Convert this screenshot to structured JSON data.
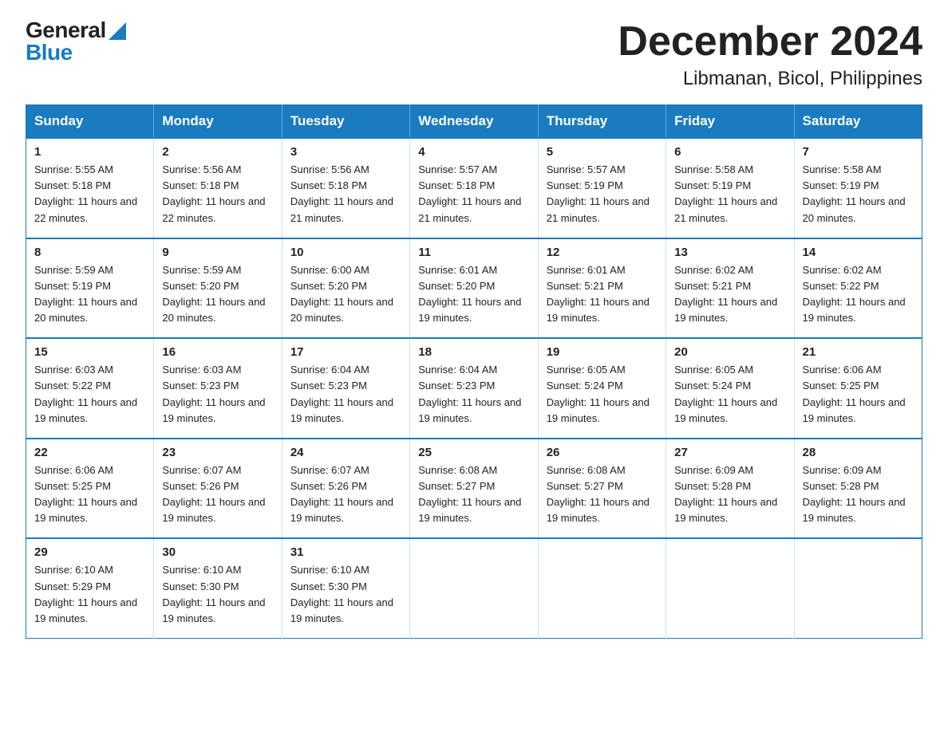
{
  "logo": {
    "general": "General",
    "blue": "Blue"
  },
  "title": "December 2024",
  "subtitle": "Libmanan, Bicol, Philippines",
  "weekdays": [
    "Sunday",
    "Monday",
    "Tuesday",
    "Wednesday",
    "Thursday",
    "Friday",
    "Saturday"
  ],
  "weeks": [
    [
      {
        "day": "1",
        "sunrise": "5:55 AM",
        "sunset": "5:18 PM",
        "daylight": "11 hours and 22 minutes."
      },
      {
        "day": "2",
        "sunrise": "5:56 AM",
        "sunset": "5:18 PM",
        "daylight": "11 hours and 22 minutes."
      },
      {
        "day": "3",
        "sunrise": "5:56 AM",
        "sunset": "5:18 PM",
        "daylight": "11 hours and 21 minutes."
      },
      {
        "day": "4",
        "sunrise": "5:57 AM",
        "sunset": "5:18 PM",
        "daylight": "11 hours and 21 minutes."
      },
      {
        "day": "5",
        "sunrise": "5:57 AM",
        "sunset": "5:19 PM",
        "daylight": "11 hours and 21 minutes."
      },
      {
        "day": "6",
        "sunrise": "5:58 AM",
        "sunset": "5:19 PM",
        "daylight": "11 hours and 21 minutes."
      },
      {
        "day": "7",
        "sunrise": "5:58 AM",
        "sunset": "5:19 PM",
        "daylight": "11 hours and 20 minutes."
      }
    ],
    [
      {
        "day": "8",
        "sunrise": "5:59 AM",
        "sunset": "5:19 PM",
        "daylight": "11 hours and 20 minutes."
      },
      {
        "day": "9",
        "sunrise": "5:59 AM",
        "sunset": "5:20 PM",
        "daylight": "11 hours and 20 minutes."
      },
      {
        "day": "10",
        "sunrise": "6:00 AM",
        "sunset": "5:20 PM",
        "daylight": "11 hours and 20 minutes."
      },
      {
        "day": "11",
        "sunrise": "6:01 AM",
        "sunset": "5:20 PM",
        "daylight": "11 hours and 19 minutes."
      },
      {
        "day": "12",
        "sunrise": "6:01 AM",
        "sunset": "5:21 PM",
        "daylight": "11 hours and 19 minutes."
      },
      {
        "day": "13",
        "sunrise": "6:02 AM",
        "sunset": "5:21 PM",
        "daylight": "11 hours and 19 minutes."
      },
      {
        "day": "14",
        "sunrise": "6:02 AM",
        "sunset": "5:22 PM",
        "daylight": "11 hours and 19 minutes."
      }
    ],
    [
      {
        "day": "15",
        "sunrise": "6:03 AM",
        "sunset": "5:22 PM",
        "daylight": "11 hours and 19 minutes."
      },
      {
        "day": "16",
        "sunrise": "6:03 AM",
        "sunset": "5:23 PM",
        "daylight": "11 hours and 19 minutes."
      },
      {
        "day": "17",
        "sunrise": "6:04 AM",
        "sunset": "5:23 PM",
        "daylight": "11 hours and 19 minutes."
      },
      {
        "day": "18",
        "sunrise": "6:04 AM",
        "sunset": "5:23 PM",
        "daylight": "11 hours and 19 minutes."
      },
      {
        "day": "19",
        "sunrise": "6:05 AM",
        "sunset": "5:24 PM",
        "daylight": "11 hours and 19 minutes."
      },
      {
        "day": "20",
        "sunrise": "6:05 AM",
        "sunset": "5:24 PM",
        "daylight": "11 hours and 19 minutes."
      },
      {
        "day": "21",
        "sunrise": "6:06 AM",
        "sunset": "5:25 PM",
        "daylight": "11 hours and 19 minutes."
      }
    ],
    [
      {
        "day": "22",
        "sunrise": "6:06 AM",
        "sunset": "5:25 PM",
        "daylight": "11 hours and 19 minutes."
      },
      {
        "day": "23",
        "sunrise": "6:07 AM",
        "sunset": "5:26 PM",
        "daylight": "11 hours and 19 minutes."
      },
      {
        "day": "24",
        "sunrise": "6:07 AM",
        "sunset": "5:26 PM",
        "daylight": "11 hours and 19 minutes."
      },
      {
        "day": "25",
        "sunrise": "6:08 AM",
        "sunset": "5:27 PM",
        "daylight": "11 hours and 19 minutes."
      },
      {
        "day": "26",
        "sunrise": "6:08 AM",
        "sunset": "5:27 PM",
        "daylight": "11 hours and 19 minutes."
      },
      {
        "day": "27",
        "sunrise": "6:09 AM",
        "sunset": "5:28 PM",
        "daylight": "11 hours and 19 minutes."
      },
      {
        "day": "28",
        "sunrise": "6:09 AM",
        "sunset": "5:28 PM",
        "daylight": "11 hours and 19 minutes."
      }
    ],
    [
      {
        "day": "29",
        "sunrise": "6:10 AM",
        "sunset": "5:29 PM",
        "daylight": "11 hours and 19 minutes."
      },
      {
        "day": "30",
        "sunrise": "6:10 AM",
        "sunset": "5:30 PM",
        "daylight": "11 hours and 19 minutes."
      },
      {
        "day": "31",
        "sunrise": "6:10 AM",
        "sunset": "5:30 PM",
        "daylight": "11 hours and 19 minutes."
      },
      null,
      null,
      null,
      null
    ]
  ],
  "labels": {
    "sunrise_prefix": "Sunrise: ",
    "sunset_prefix": "Sunset: ",
    "daylight_prefix": "Daylight: "
  }
}
